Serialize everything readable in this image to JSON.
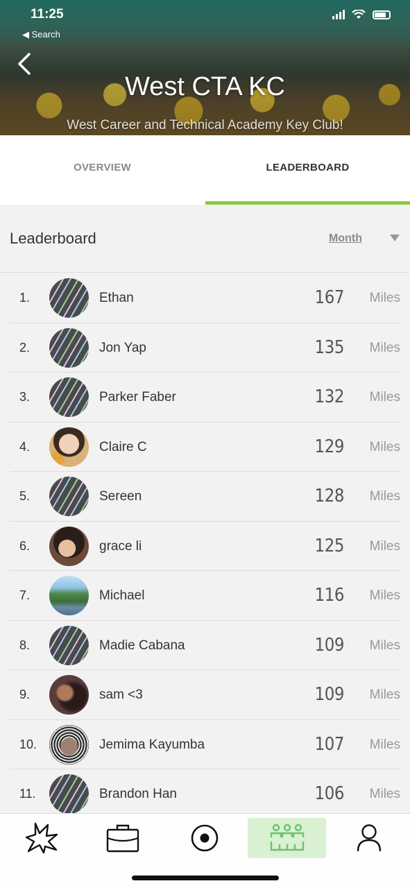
{
  "status_bar": {
    "time": "11:25",
    "back_app": "◀ Search"
  },
  "header": {
    "title": "West CTA KC",
    "subtitle": "West Career and Technical Academy Key Club!"
  },
  "tabs": [
    {
      "label": "OVERVIEW",
      "active": false
    },
    {
      "label": "LEADERBOARD",
      "active": true
    }
  ],
  "leaderboard": {
    "title": "Leaderboard",
    "period": "Month",
    "rows": [
      {
        "rank": "1.",
        "name": "Ethan",
        "value": "167",
        "unit": "Miles",
        "avatar": "default-striped"
      },
      {
        "rank": "2.",
        "name": "Jon Yap",
        "value": "135",
        "unit": "Miles",
        "avatar": "default-striped"
      },
      {
        "rank": "3.",
        "name": "Parker Faber",
        "value": "132",
        "unit": "Miles",
        "avatar": "default-striped"
      },
      {
        "rank": "4.",
        "name": "Claire C",
        "value": "129",
        "unit": "Miles",
        "avatar": "photo"
      },
      {
        "rank": "5.",
        "name": "Sereen",
        "value": "128",
        "unit": "Miles",
        "avatar": "default-striped"
      },
      {
        "rank": "6.",
        "name": "grace li",
        "value": "125",
        "unit": "Miles",
        "avatar": "photo"
      },
      {
        "rank": "7.",
        "name": "Michael",
        "value": "116",
        "unit": "Miles",
        "avatar": "photo"
      },
      {
        "rank": "8.",
        "name": "Madie Cabana",
        "value": "109",
        "unit": "Miles",
        "avatar": "default-striped"
      },
      {
        "rank": "9.",
        "name": "sam <3",
        "value": "109",
        "unit": "Miles",
        "avatar": "photo"
      },
      {
        "rank": "10.",
        "name": "Jemima Kayumba",
        "value": "107",
        "unit": "Miles",
        "avatar": "photo"
      },
      {
        "rank": "11.",
        "name": "Brandon Han",
        "value": "106",
        "unit": "Miles",
        "avatar": "default-striped"
      }
    ]
  },
  "bottom_nav": [
    {
      "icon": "burst-icon",
      "active": false
    },
    {
      "icon": "briefcase-icon",
      "active": false
    },
    {
      "icon": "record-icon",
      "active": false
    },
    {
      "icon": "group-icon",
      "active": true
    },
    {
      "icon": "profile-icon",
      "active": false
    }
  ],
  "colors": {
    "accent": "#8fc93a",
    "nav_active_bg": "#d9f0d2",
    "nav_active_icon": "#6cc36a"
  }
}
